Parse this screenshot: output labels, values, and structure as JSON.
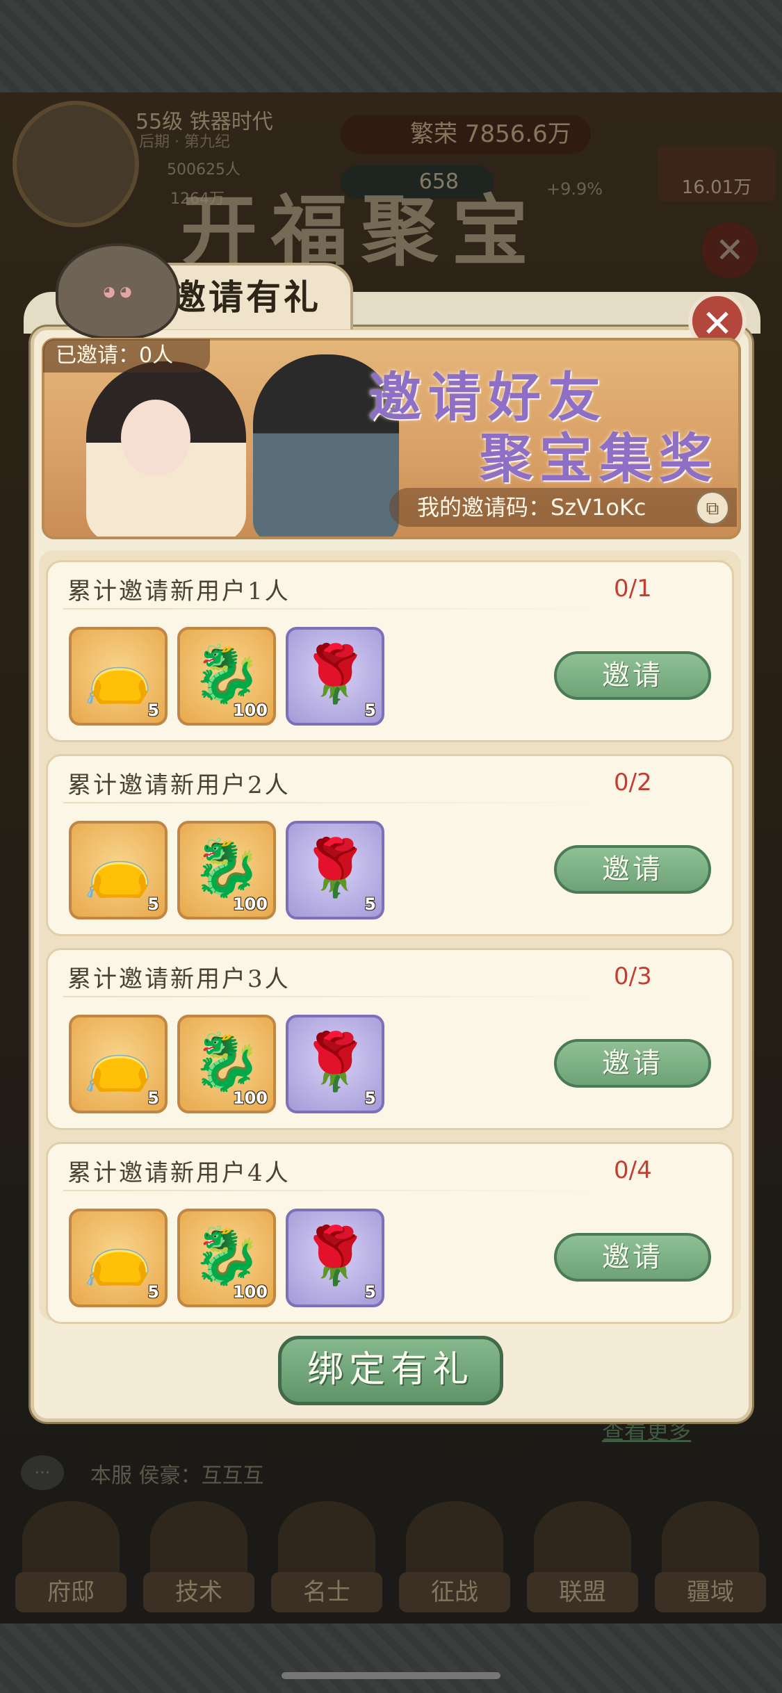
{
  "background": {
    "level": "55级 铁器时代",
    "era": "后期 · 第九纪",
    "population": "500625人",
    "food": "1264万",
    "prosperity": "繁荣 7856.6万",
    "gold": "658",
    "growth": "+9.9%",
    "silver": "16.01万",
    "banner_title": "开福聚宝",
    "more_link": "查看更多",
    "chat_text": "本服 侯豪：互互互",
    "nav": [
      "府邸",
      "技术",
      "名士",
      "征战",
      "联盟",
      "疆域"
    ]
  },
  "modal": {
    "title": "邀请有礼",
    "close_icon": "close-icon",
    "hero": {
      "invited_count": "已邀请：0人",
      "headline_1": "邀请好友",
      "headline_2": "聚宝集奖",
      "invite_code": "我的邀请码：SzV1oKc"
    },
    "tasks": [
      {
        "title": "累计邀请新用户1人",
        "progress": "0/1",
        "button": "邀请",
        "rewards": [
          {
            "icon": "pouch-icon",
            "count": "5",
            "bg": "gold"
          },
          {
            "icon": "jade-dragon-icon",
            "count": "100",
            "bg": "gold"
          },
          {
            "icon": "rose-icon",
            "count": "5",
            "bg": "purple"
          }
        ]
      },
      {
        "title": "累计邀请新用户2人",
        "progress": "0/2",
        "button": "邀请",
        "rewards": [
          {
            "icon": "pouch-icon",
            "count": "5",
            "bg": "gold"
          },
          {
            "icon": "jade-dragon-icon",
            "count": "100",
            "bg": "gold"
          },
          {
            "icon": "rose-icon",
            "count": "5",
            "bg": "purple"
          }
        ]
      },
      {
        "title": "累计邀请新用户3人",
        "progress": "0/3",
        "button": "邀请",
        "rewards": [
          {
            "icon": "pouch-icon",
            "count": "5",
            "bg": "gold"
          },
          {
            "icon": "jade-dragon-icon",
            "count": "100",
            "bg": "gold"
          },
          {
            "icon": "rose-icon",
            "count": "5",
            "bg": "purple"
          }
        ]
      },
      {
        "title": "累计邀请新用户4人",
        "progress": "0/4",
        "button": "邀请",
        "rewards": [
          {
            "icon": "pouch-icon",
            "count": "5",
            "bg": "gold"
          },
          {
            "icon": "jade-dragon-icon",
            "count": "100",
            "bg": "gold"
          },
          {
            "icon": "rose-icon",
            "count": "5",
            "bg": "purple"
          }
        ]
      }
    ],
    "bind_button": "绑定有礼"
  },
  "colors": {
    "progress_red": "#c43c32",
    "button_green": "#6ea277",
    "panel_cream": "#fbf6e6",
    "headline_purple": "#8e6fc6"
  }
}
